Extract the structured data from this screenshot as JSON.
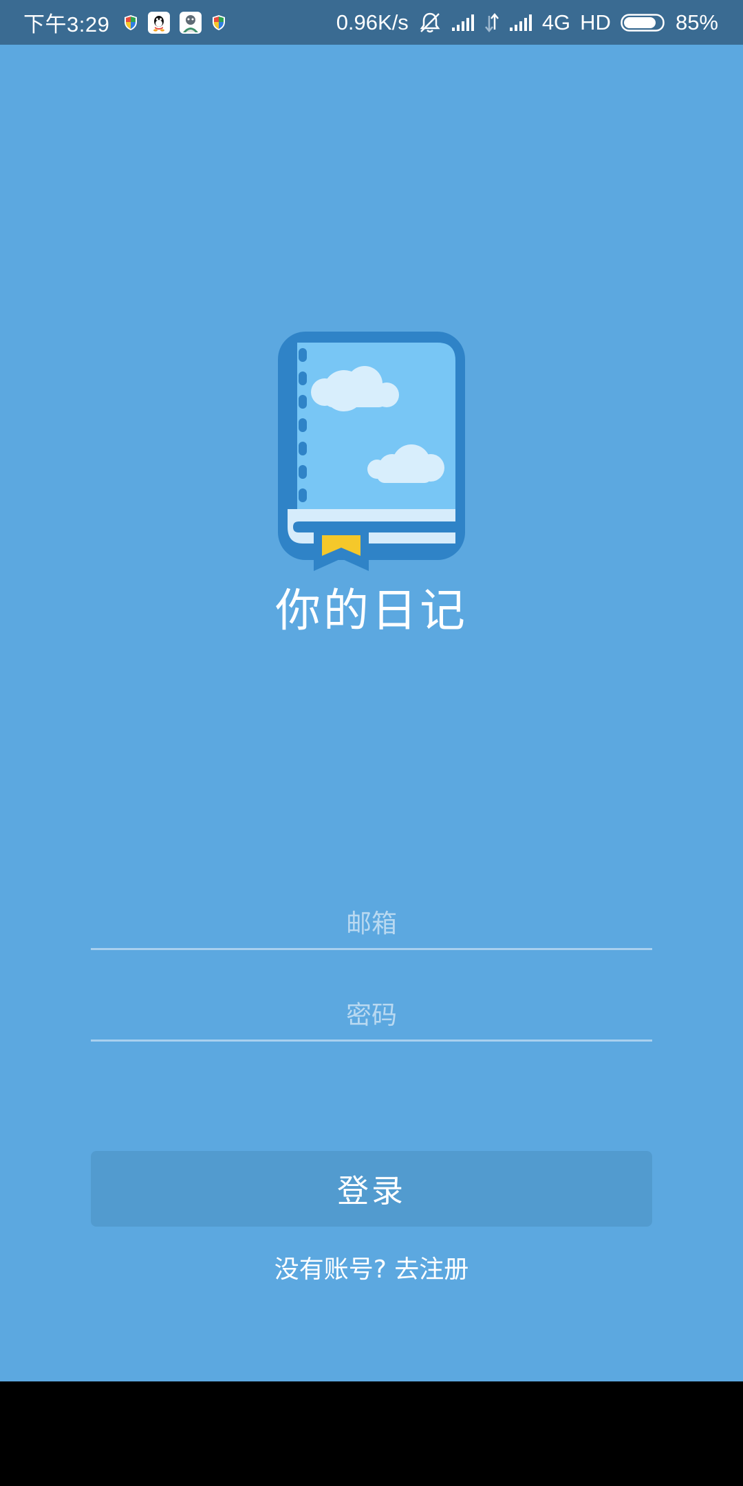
{
  "status_bar": {
    "time": "下午3:29",
    "network_speed": "0.96K/s",
    "network_type": "4G",
    "hd_label": "HD",
    "battery_percent": "85%",
    "battery_level": 0.85,
    "left_icons": [
      "security-shield-icon",
      "qq-icon",
      "app-avatar-icon",
      "security-shield-icon"
    ],
    "right_icons": [
      "vibrate-off-icon",
      "signal-icon",
      "data-arrows-icon",
      "signal-icon",
      "battery-icon"
    ]
  },
  "app": {
    "title": "你的日记",
    "logo_icon": "diary-book-icon"
  },
  "form": {
    "email_placeholder": "邮箱",
    "email_value": "",
    "password_placeholder": "密码",
    "password_value": "",
    "login_label": "登录",
    "register_prompt": "没有账号? 去注册"
  },
  "colors": {
    "background": "#5ca8e0",
    "status_bar": "#3a6b92",
    "button": "#529bcf",
    "underline": "#a9d0ef",
    "bookmark": "#f5c82a"
  }
}
